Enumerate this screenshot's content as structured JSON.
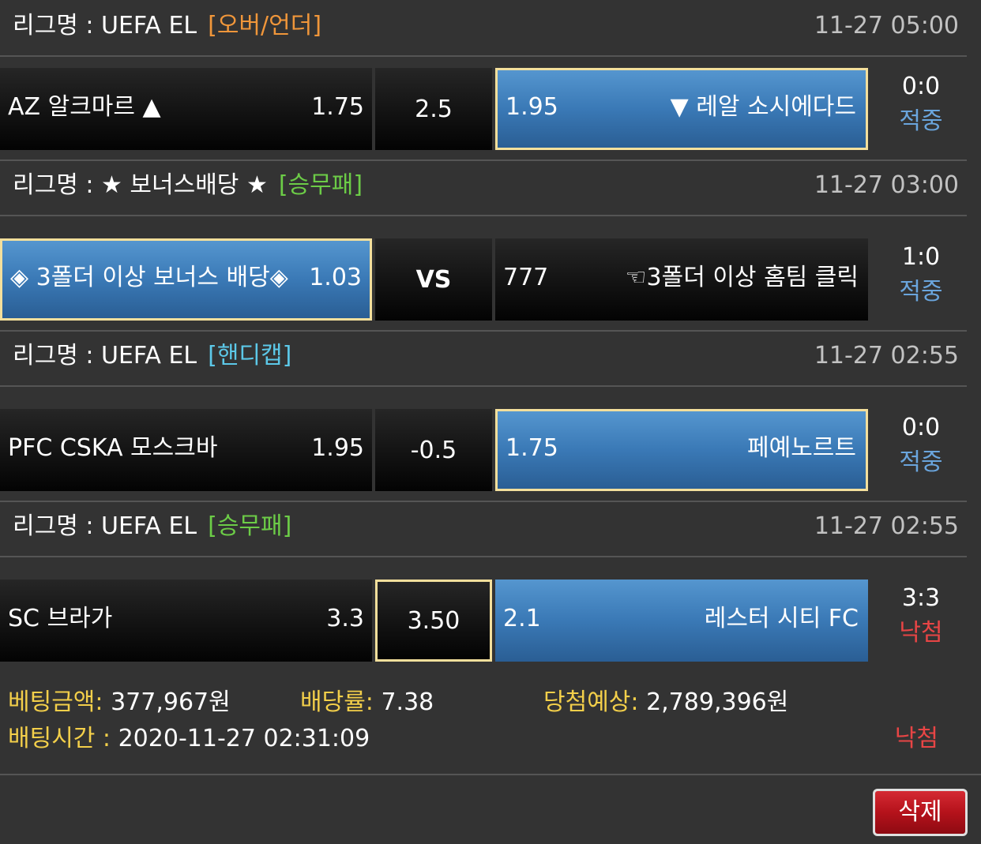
{
  "colors": {
    "type_over_under": "#f0963a",
    "type_win_draw_lose": "#6ccc47",
    "type_handicap": "#5cc8e8",
    "status_hit": "#6aa5dd",
    "status_miss": "#e84545",
    "summary_label": "#f3cf4a",
    "selected_cell": "#3a79b6",
    "highlight_border": "#f3df9c",
    "delete_button": "#b5121b"
  },
  "bets": [
    {
      "league_prefix": "리그명 : UEFA EL",
      "bet_type": "[오버/언더]",
      "bet_type_color": "#f0963a",
      "time": "11-27 05:00",
      "home_name": "AZ 알크마르 ▲",
      "home_odds": "1.75",
      "mid": "2.5",
      "away_odds": "1.95",
      "away_name": "▼ 레알 소시에다드",
      "score": "0:0",
      "status": "적중",
      "status_color": "#6aa5dd",
      "selected": "away"
    },
    {
      "league_prefix": "리그명 : ★ 보너스배당 ★",
      "bet_type": "[승무패]",
      "bet_type_color": "#6ccc47",
      "time": "11-27 03:00",
      "home_name": "◈ 3폴더 이상 보너스 배당◈",
      "home_odds": "1.03",
      "mid": "VS",
      "away_odds": "777",
      "away_name": "☜3폴더 이상 홈팀 클릭",
      "score": "1:0",
      "status": "적중",
      "status_color": "#6aa5dd",
      "selected": "home"
    },
    {
      "league_prefix": "리그명 : UEFA EL",
      "bet_type": "[핸디캡]",
      "bet_type_color": "#5cc8e8",
      "time": "11-27 02:55",
      "home_name": "PFC CSKA 모스크바",
      "home_odds": "1.95",
      "mid": "-0.5",
      "away_odds": "1.75",
      "away_name": "페예노르트",
      "score": "0:0",
      "status": "적중",
      "status_color": "#6aa5dd",
      "selected": "away"
    },
    {
      "league_prefix": "리그명 : UEFA EL",
      "bet_type": "[승무패]",
      "bet_type_color": "#6ccc47",
      "time": "11-27 02:55",
      "home_name": "SC 브라가",
      "home_odds": "3.3",
      "mid": "3.50",
      "away_odds": "2.1",
      "away_name": "레스터 시티 FC",
      "score": "3:3",
      "status": "낙첨",
      "status_color": "#e84545",
      "selected": "away"
    }
  ],
  "summary": {
    "bet_amount_label": "베팅금액:",
    "bet_amount_value": "377,967원",
    "odds_rate_label": "배당률:",
    "odds_rate_value": "7.38",
    "expected_win_label": "당첨예상:",
    "expected_win_value": "2,789,396원",
    "bet_time_label": "배팅시간 :",
    "bet_time_value": "2020-11-27 02:31:09",
    "result_status": "낙첨"
  },
  "actions": {
    "delete_label": "삭제"
  }
}
